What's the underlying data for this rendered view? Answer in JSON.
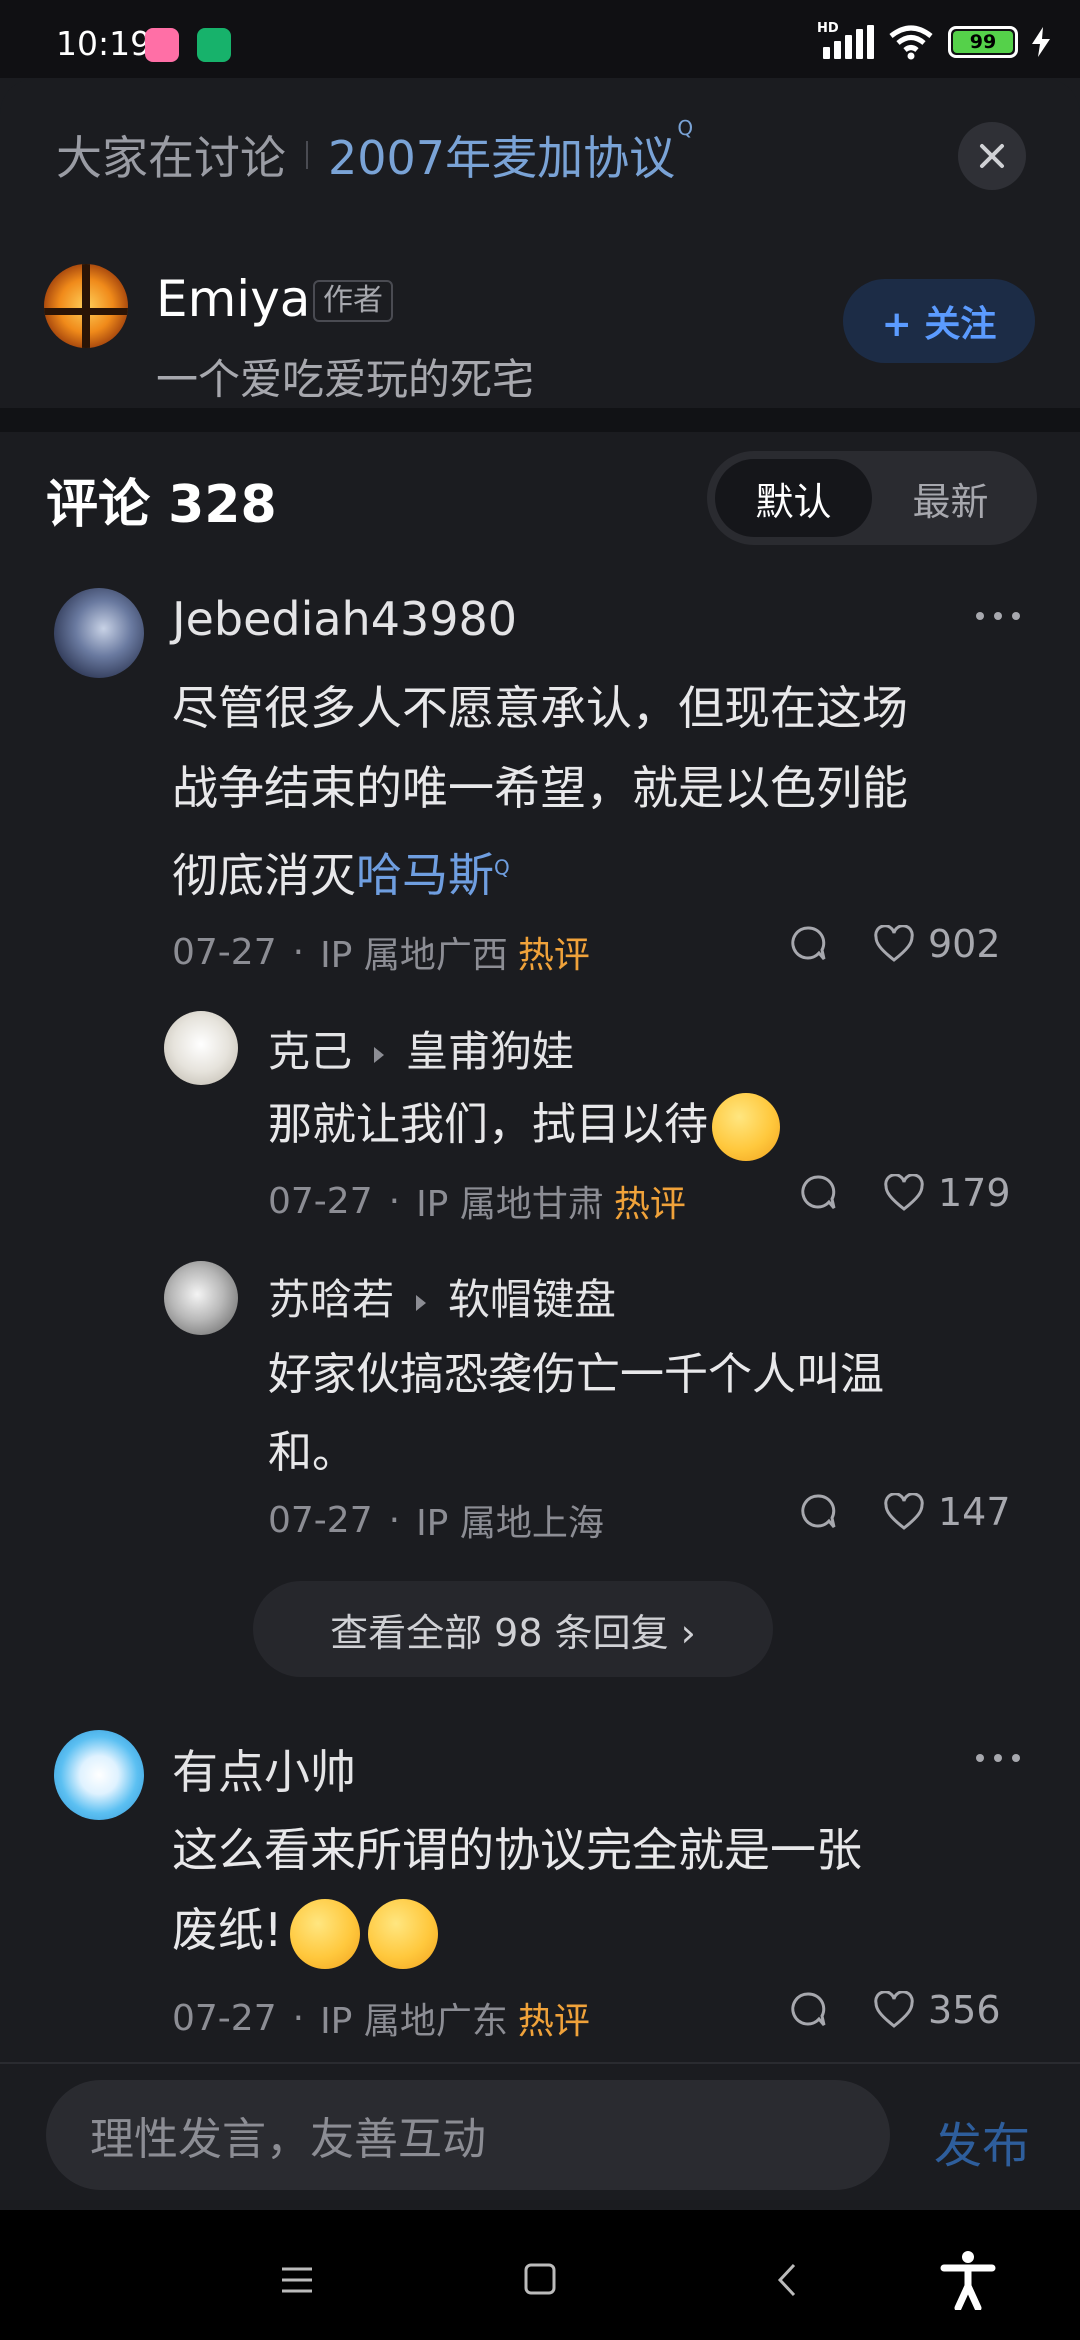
{
  "status_bar": {
    "time": "10:19",
    "network_label": "HD",
    "battery": "99"
  },
  "header": {
    "topic_prefix": "大家在讨论",
    "topic_link": "2007年麦加协议",
    "topic_mark": "Q"
  },
  "author": {
    "name": "Emiya",
    "tag": "作者",
    "bio": "一个爱吃爱玩的死宅",
    "follow_label": "+ 关注"
  },
  "comments_header": {
    "title": "评论 328",
    "sort_tabs": [
      "默认",
      "最新"
    ],
    "active_tab": "默认"
  },
  "comments": [
    {
      "user": "Jebediah43980",
      "text_lines": [
        "尽管很多人不愿意承认，但现在这场",
        "战争结束的唯一希望，就是以色列能"
      ],
      "text_line3_prefix": "彻底消灭",
      "text_link": "哈马斯",
      "link_mark": "Q",
      "date": "07-27",
      "ip": "IP 属地广西",
      "badge": "热评",
      "likes": "902",
      "replies": [
        {
          "user": "克己",
          "reply_to": "皇甫狗娃",
          "text": "那就让我们，拭目以待",
          "date": "07-27",
          "ip": "IP 属地甘肃",
          "badge": "热评",
          "likes": "179"
        },
        {
          "user": "苏晗若",
          "reply_to": "软帽键盘",
          "text_lines": [
            "好家伙搞恐袭伤亡一千个人叫温",
            "和。"
          ],
          "date": "07-27",
          "ip": "IP 属地上海",
          "likes": "147"
        }
      ],
      "view_all": "查看全部 98 条回复 ›"
    },
    {
      "user": "有点小帅",
      "text_lines": [
        "这么看来所谓的协议完全就是一张"
      ],
      "text_line2": "废纸!",
      "date": "07-27",
      "ip": "IP 属地广东",
      "badge": "热评",
      "likes": "356"
    }
  ],
  "input": {
    "placeholder": "理性发言，友善互动",
    "publish_label": "发布"
  },
  "colors": {
    "background": "#1b1c20",
    "accent_blue": "#5b9bff",
    "link_blue": "#6f9ee0",
    "hot_orange": "#f0a23a",
    "battery_green": "#55d14a"
  }
}
